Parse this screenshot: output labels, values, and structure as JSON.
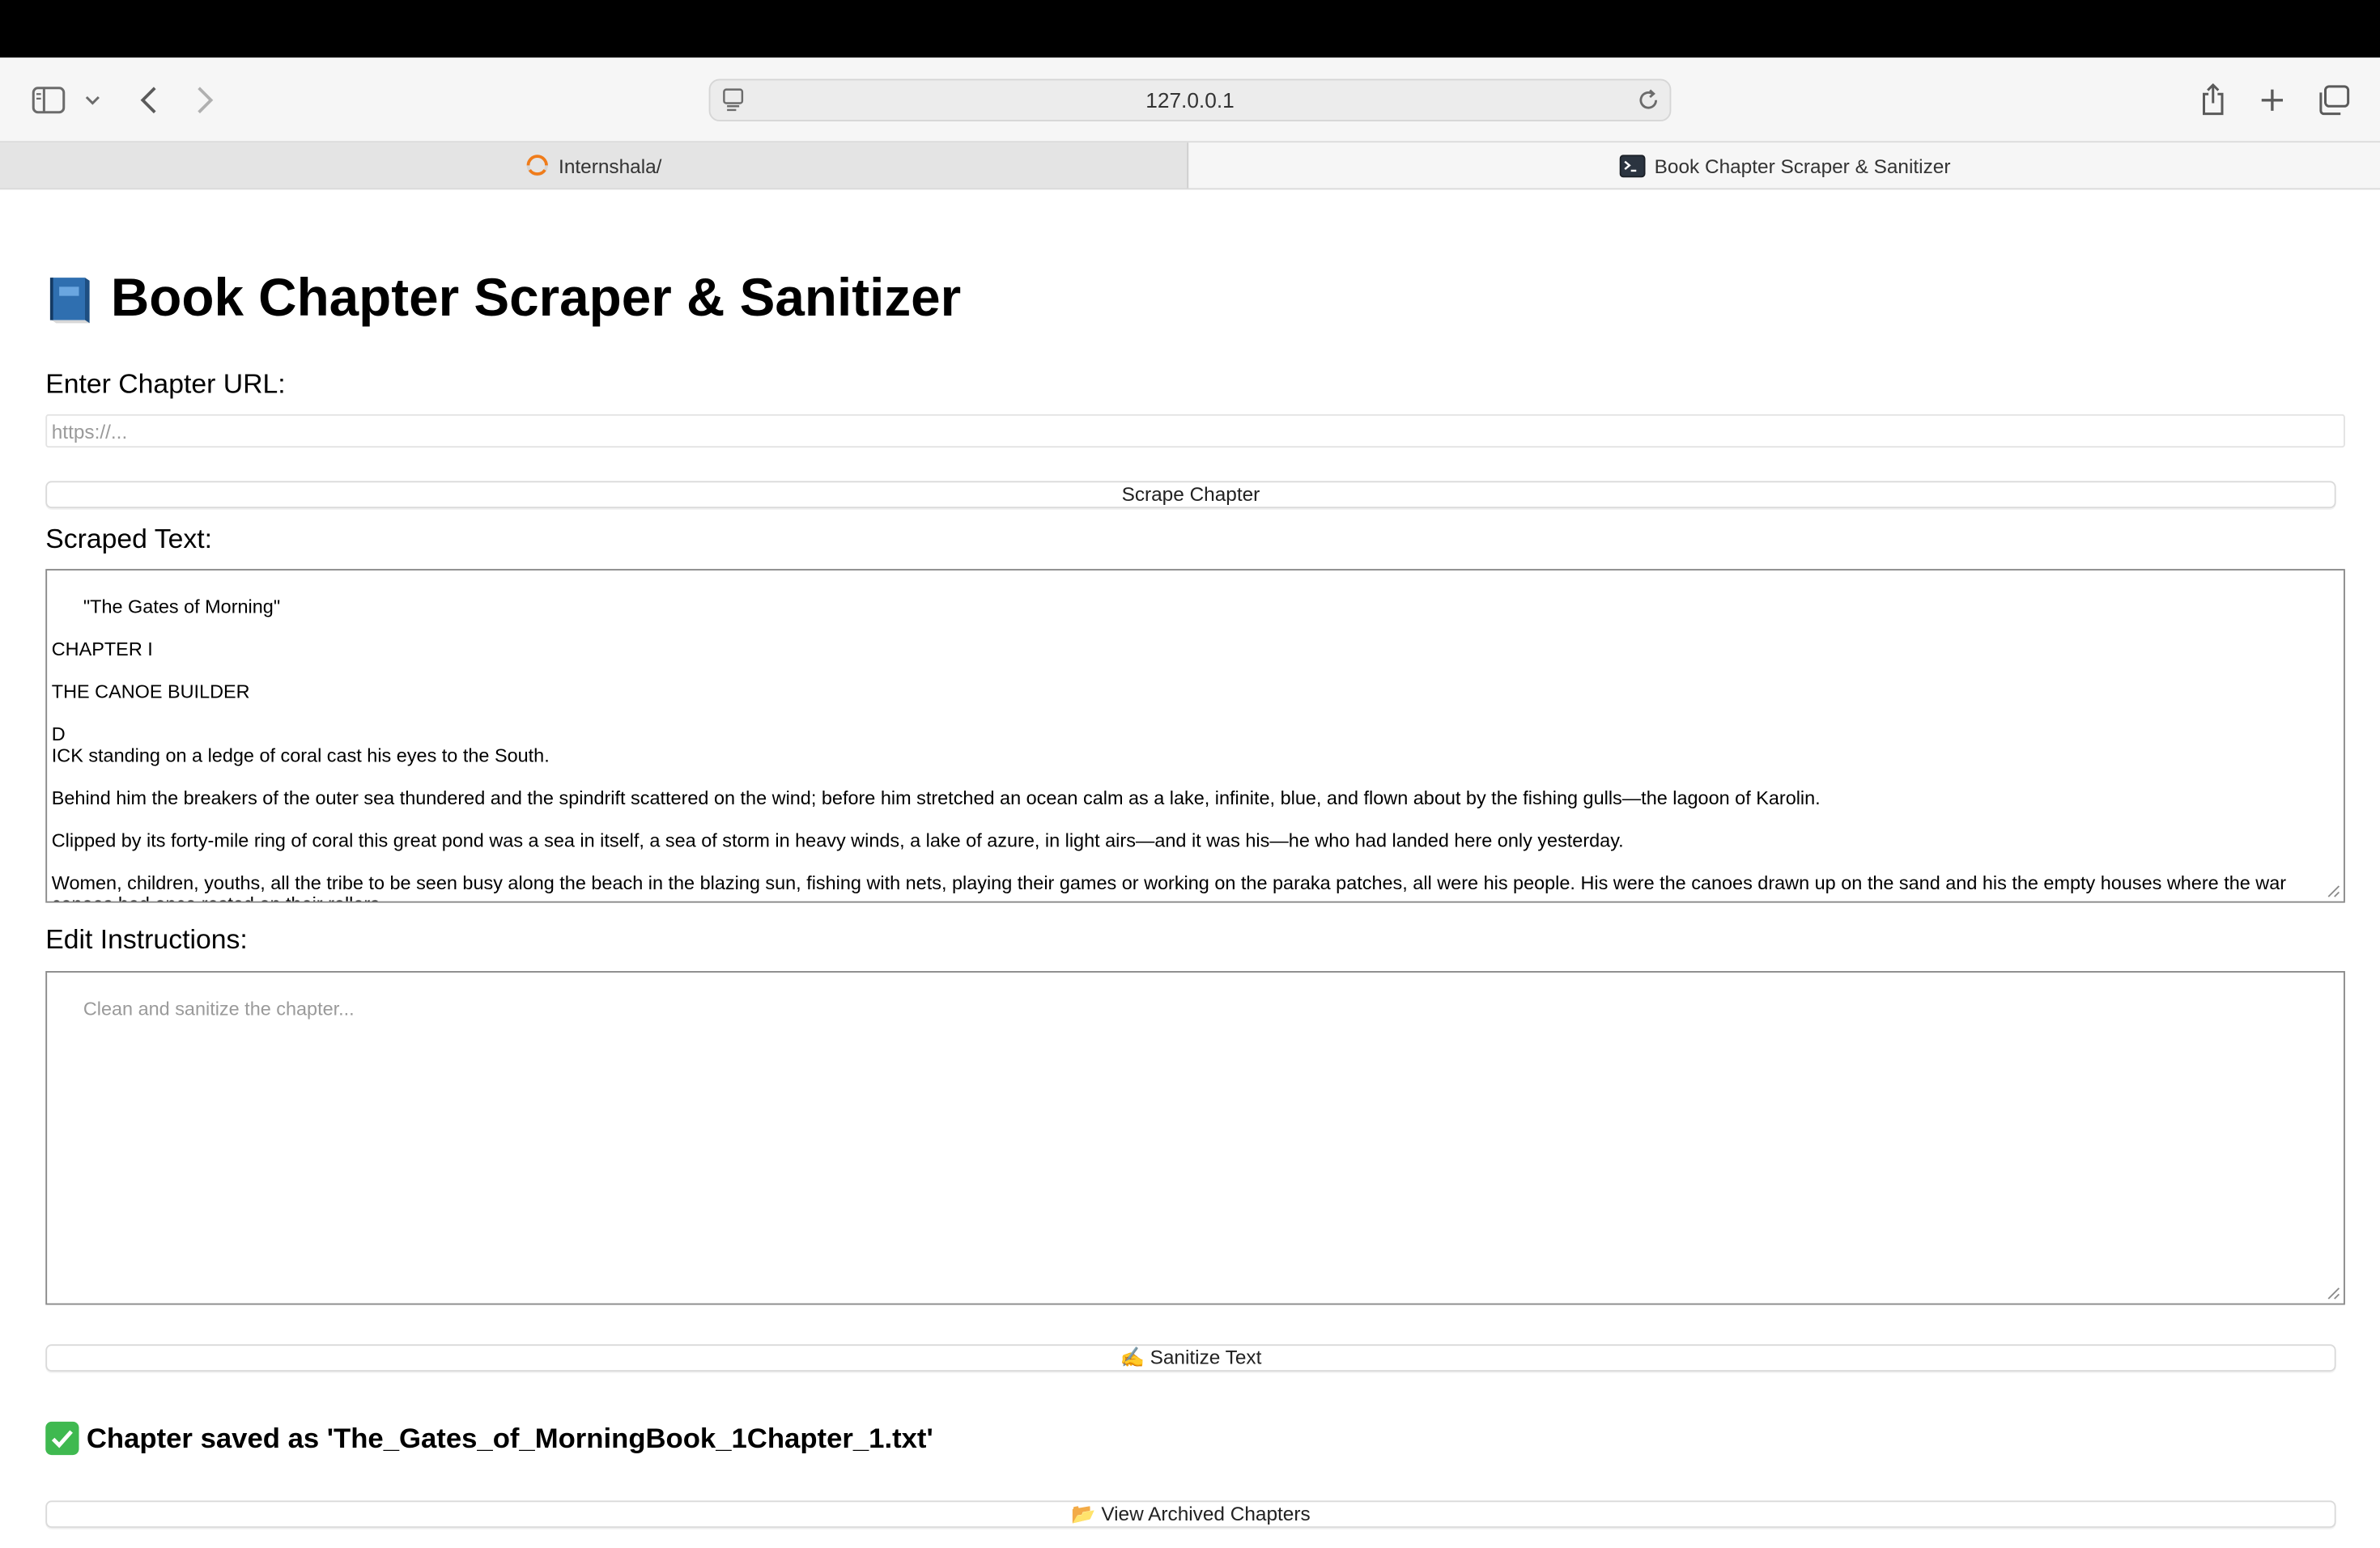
{
  "browser": {
    "url": "127.0.0.1",
    "tabs": [
      {
        "label": "Internshala/",
        "active": false,
        "icon": "loading-spinner-icon"
      },
      {
        "label": "Book Chapter Scraper & Sanitizer",
        "active": true,
        "icon": "terminal-icon"
      }
    ]
  },
  "page": {
    "title": "Book Chapter Scraper & Sanitizer",
    "title_icon": "blue-book-icon",
    "url_label": "Enter Chapter URL:",
    "url_placeholder": "https://...",
    "scrape_button": "Scrape Chapter",
    "scraped_label": "Scraped Text:",
    "scraped_text": "\"The Gates of Morning\"\n\nCHAPTER I\n\nTHE CANOE BUILDER\n\nD\nICK standing on a ledge of coral cast his eyes to the South.\n\nBehind him the breakers of the outer sea thundered and the spindrift scattered on the wind; before him stretched an ocean calm as a lake, infinite, blue, and flown about by the fishing gulls—the lagoon of Karolin.\n\nClipped by its forty-mile ring of coral this great pond was a sea in itself, a sea of storm in heavy winds, a lake of azure, in light airs—and it was his—he who had landed here only yesterday.\n\nWomen, children, youths, all the tribe to be seen busy along the beach in the blazing sun, fishing with nets, playing their games or working on the paraka patches, all were his people. His were the canoes drawn up on the sand and his the empty houses where the war canoes had once rested on their rollers.",
    "edit_label": "Edit Instructions:",
    "edit_placeholder": "Clean and sanitize the chapter...",
    "sanitize_button": "✍️ Sanitize Text",
    "status_message": "Chapter saved as 'The_Gates_of_MorningBook_1Chapter_1.txt'",
    "status_icon": "check-mark-icon",
    "archive_button": "📂 View Archived Chapters"
  },
  "colors": {
    "success": "#3fb950",
    "book_blue": "#2f6fb0"
  }
}
